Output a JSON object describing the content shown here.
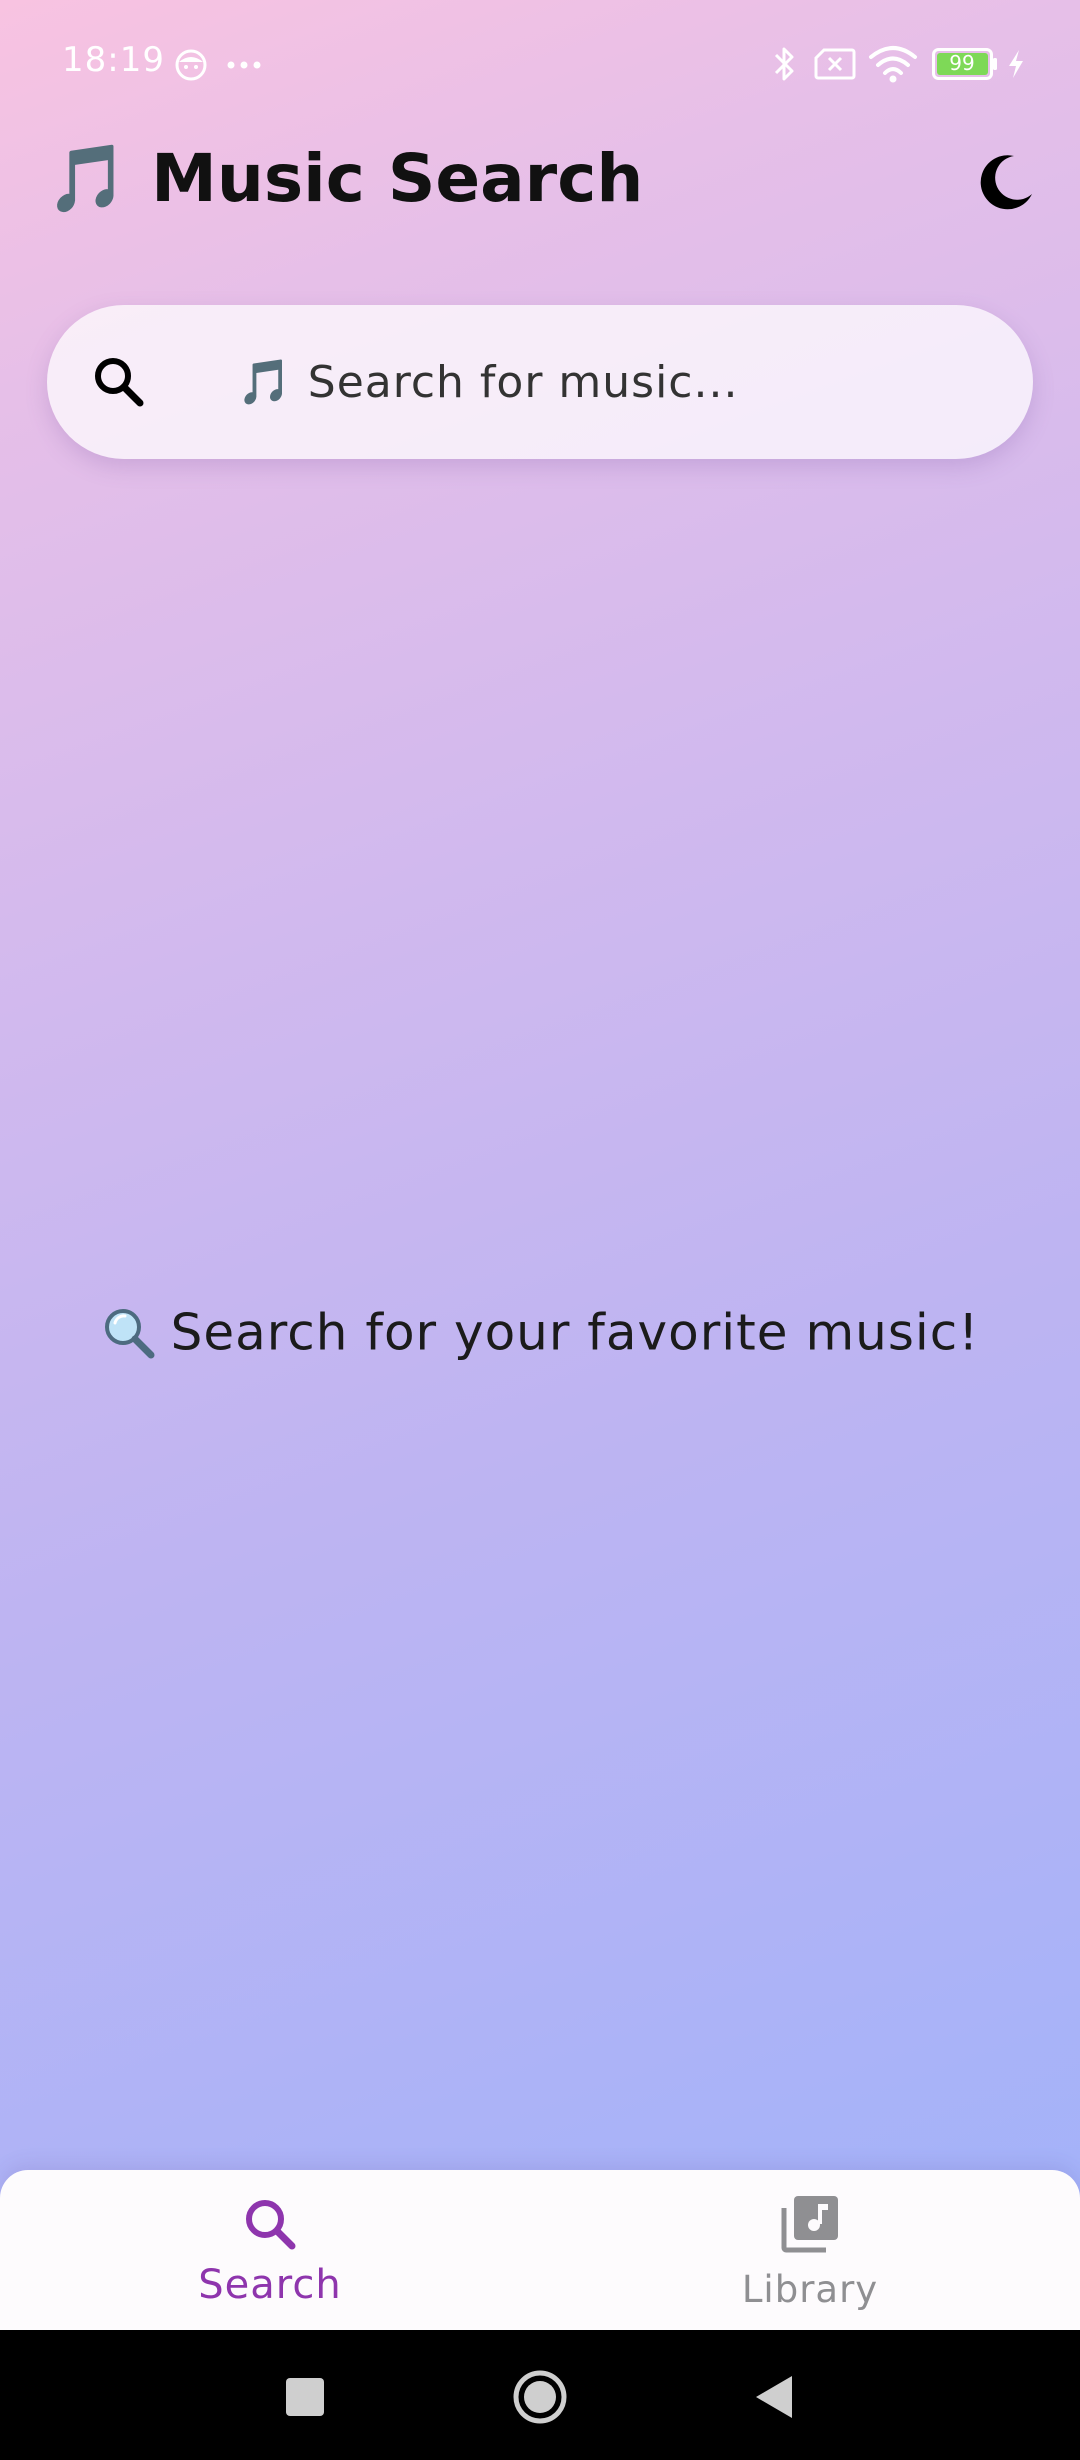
{
  "status_bar": {
    "time": "18:19",
    "battery_level": "99",
    "icons": [
      "face-icon",
      "more-dots-icon",
      "bluetooth-icon",
      "no-sim-icon",
      "wifi-icon",
      "battery-icon",
      "charging-icon"
    ]
  },
  "header": {
    "title": "🎵 Music Search",
    "theme_toggle_icon": "moon-icon"
  },
  "search": {
    "placeholder": "🎵 Search for music...",
    "value": ""
  },
  "empty_state": {
    "message": "Search for your favorite music!"
  },
  "bottom_nav": {
    "items": [
      {
        "label": "Search",
        "icon": "search-icon",
        "active": true,
        "color": "#8e35ad"
      },
      {
        "label": "Library",
        "icon": "library-music-icon",
        "active": false,
        "color": "#8f8f92"
      }
    ]
  },
  "system_nav": {
    "buttons": [
      "recents-button",
      "home-button",
      "back-button"
    ]
  },
  "colors": {
    "accent": "#8e35ad",
    "gradient_top": "#f8c3e1",
    "gradient_bottom": "#9db2fb",
    "battery_green": "#7ed957"
  }
}
